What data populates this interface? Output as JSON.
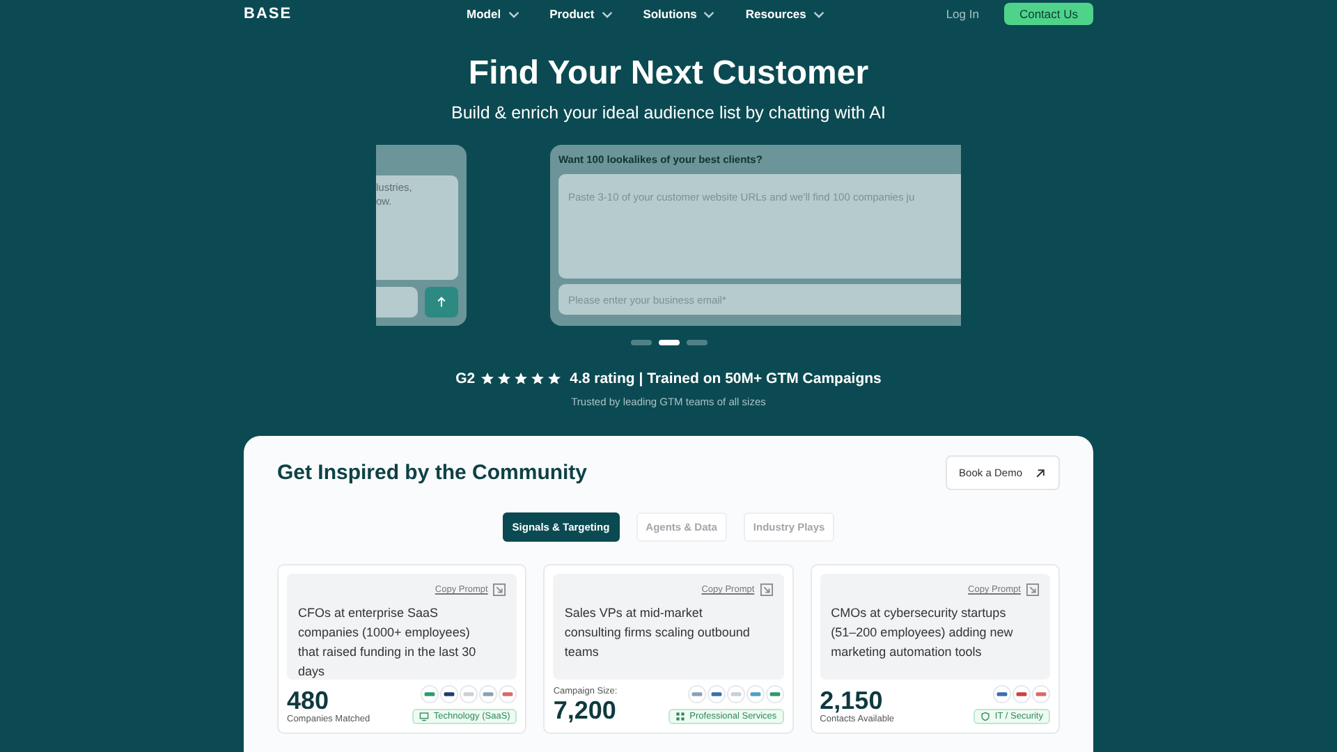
{
  "nav": {
    "logo": "BASE",
    "menu": [
      {
        "label": "Model"
      },
      {
        "label": "Product"
      },
      {
        "label": "Solutions"
      },
      {
        "label": "Resources"
      }
    ],
    "login": "Log In",
    "cta": "Contact Us"
  },
  "hero": {
    "title": "Find Your Next Customer",
    "subtitle": "Build & enrich your ideal audience list by chatting with AI",
    "carousel": {
      "prev_card": {
        "text": "lustries,\now."
      },
      "card": {
        "title": "Want 100 lookalikes of your best clients?",
        "placeholder": "Paste 3-10 of your customer website URLs and we'll find 100 companies ju",
        "email_placeholder": "Please enter your business email*"
      },
      "dots": [
        {
          "selected": false
        },
        {
          "selected": true
        },
        {
          "selected": false
        }
      ]
    },
    "rating": {
      "brand": "G2",
      "stars": 5,
      "text": "4.8 rating | Trained on 50M+ GTM Campaigns"
    },
    "trusted": "Trusted by leading GTM teams of all sizes"
  },
  "community": {
    "title": "Get Inspired by the Community",
    "book_button": "Book a Demo",
    "tabs": [
      {
        "label": "Signals & Targeting",
        "selected": true
      },
      {
        "label": "Agents & Data",
        "selected": false
      },
      {
        "label": "Industry Plays",
        "selected": false
      }
    ],
    "cards": [
      {
        "copy": "Copy Prompt",
        "prompt": "CFOs at enterprise SaaS companies (1000+ employees) that raised funding in the last 30 days",
        "number": "480",
        "label": "Companies Matched",
        "tag": {
          "kind": "monitor",
          "label": "Technology (SaaS)"
        },
        "logos": [
          {
            "color": "#2a9d6a"
          },
          {
            "color": "#1d3b6e"
          },
          {
            "color": "#c8d0d8"
          },
          {
            "color": "#8aa0b8"
          },
          {
            "color": "#d96a6a"
          }
        ]
      },
      {
        "copy": "Copy Prompt",
        "prompt": "Sales VPs at mid-market consulting firms scaling outbound teams",
        "pre_label": "Campaign Size:",
        "number": "7,200",
        "tag": {
          "kind": "grid",
          "label": "Professional Services"
        },
        "logos": [
          {
            "color": "#8aa0b8"
          },
          {
            "color": "#3a6fb0"
          },
          {
            "color": "#c8d0d8"
          },
          {
            "color": "#4aa3c8"
          },
          {
            "color": "#2a9d6a"
          }
        ]
      },
      {
        "copy": "Copy Prompt",
        "prompt": "CMOs at cybersecurity startups (51–200 employees) adding new marketing automation tools",
        "number": "2,150",
        "label": "Contacts Available",
        "tag": {
          "kind": "shield",
          "label": "IT / Security"
        },
        "logos": [
          {
            "color": "#3a6fb0"
          },
          {
            "color": "#d04040"
          },
          {
            "color": "#d96a6a"
          }
        ]
      }
    ]
  }
}
